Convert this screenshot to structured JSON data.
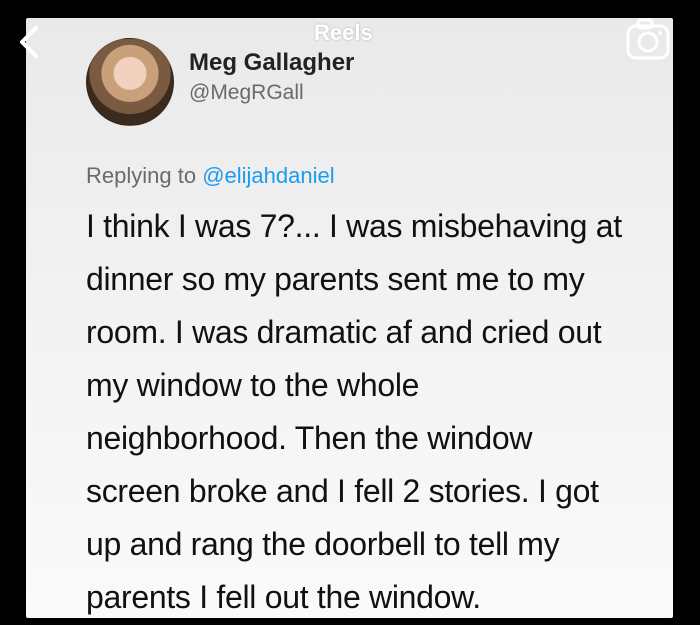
{
  "header": {
    "reels_label": "Reels"
  },
  "tweet": {
    "author_name": "Meg Gallagher",
    "author_handle": "@MegRGall",
    "replying_prefix": "Replying to",
    "replying_mention": "@elijahdaniel",
    "body_lines": [
      "I think I was 7?... I was misbehaving at",
      "dinner so my parents sent me to my",
      "room. I was dramatic af and cried out",
      "my window to the whole",
      "neighborhood. Then the window",
      "screen broke and I fell 2 stories. I got",
      "up and rang the doorbell to tell my",
      "parents I fell out the window."
    ]
  },
  "icons": {
    "back": "chevron-left-icon",
    "camera": "camera-icon"
  },
  "colors": {
    "mention": "#1d9bf0",
    "background": "#000000"
  }
}
